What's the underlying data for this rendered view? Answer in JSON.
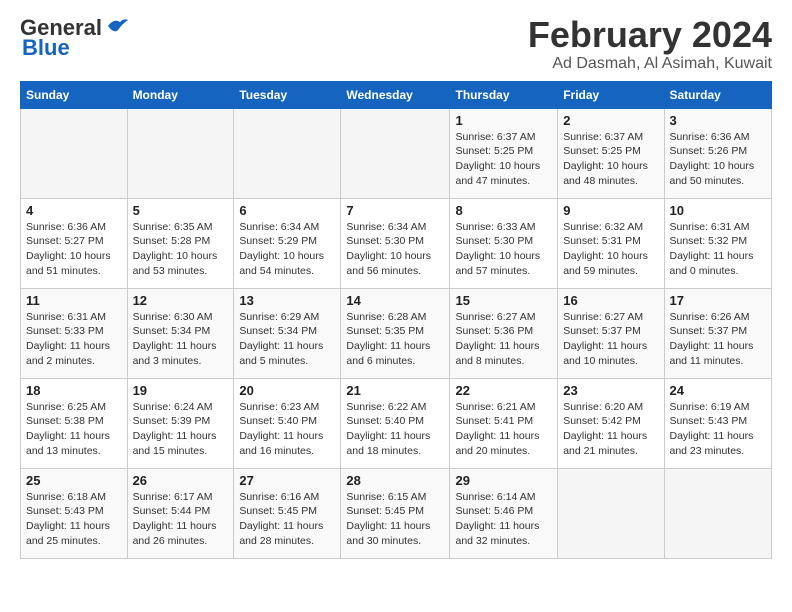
{
  "logo": {
    "line1": "General",
    "line2": "Blue"
  },
  "title": "February 2024",
  "subtitle": "Ad Dasmah, Al Asimah, Kuwait",
  "days_of_week": [
    "Sunday",
    "Monday",
    "Tuesday",
    "Wednesday",
    "Thursday",
    "Friday",
    "Saturday"
  ],
  "weeks": [
    [
      {
        "day": "",
        "info": ""
      },
      {
        "day": "",
        "info": ""
      },
      {
        "day": "",
        "info": ""
      },
      {
        "day": "",
        "info": ""
      },
      {
        "day": "1",
        "info": "Sunrise: 6:37 AM\nSunset: 5:25 PM\nDaylight: 10 hours\nand 47 minutes."
      },
      {
        "day": "2",
        "info": "Sunrise: 6:37 AM\nSunset: 5:25 PM\nDaylight: 10 hours\nand 48 minutes."
      },
      {
        "day": "3",
        "info": "Sunrise: 6:36 AM\nSunset: 5:26 PM\nDaylight: 10 hours\nand 50 minutes."
      }
    ],
    [
      {
        "day": "4",
        "info": "Sunrise: 6:36 AM\nSunset: 5:27 PM\nDaylight: 10 hours\nand 51 minutes."
      },
      {
        "day": "5",
        "info": "Sunrise: 6:35 AM\nSunset: 5:28 PM\nDaylight: 10 hours\nand 53 minutes."
      },
      {
        "day": "6",
        "info": "Sunrise: 6:34 AM\nSunset: 5:29 PM\nDaylight: 10 hours\nand 54 minutes."
      },
      {
        "day": "7",
        "info": "Sunrise: 6:34 AM\nSunset: 5:30 PM\nDaylight: 10 hours\nand 56 minutes."
      },
      {
        "day": "8",
        "info": "Sunrise: 6:33 AM\nSunset: 5:30 PM\nDaylight: 10 hours\nand 57 minutes."
      },
      {
        "day": "9",
        "info": "Sunrise: 6:32 AM\nSunset: 5:31 PM\nDaylight: 10 hours\nand 59 minutes."
      },
      {
        "day": "10",
        "info": "Sunrise: 6:31 AM\nSunset: 5:32 PM\nDaylight: 11 hours\nand 0 minutes."
      }
    ],
    [
      {
        "day": "11",
        "info": "Sunrise: 6:31 AM\nSunset: 5:33 PM\nDaylight: 11 hours\nand 2 minutes."
      },
      {
        "day": "12",
        "info": "Sunrise: 6:30 AM\nSunset: 5:34 PM\nDaylight: 11 hours\nand 3 minutes."
      },
      {
        "day": "13",
        "info": "Sunrise: 6:29 AM\nSunset: 5:34 PM\nDaylight: 11 hours\nand 5 minutes."
      },
      {
        "day": "14",
        "info": "Sunrise: 6:28 AM\nSunset: 5:35 PM\nDaylight: 11 hours\nand 6 minutes."
      },
      {
        "day": "15",
        "info": "Sunrise: 6:27 AM\nSunset: 5:36 PM\nDaylight: 11 hours\nand 8 minutes."
      },
      {
        "day": "16",
        "info": "Sunrise: 6:27 AM\nSunset: 5:37 PM\nDaylight: 11 hours\nand 10 minutes."
      },
      {
        "day": "17",
        "info": "Sunrise: 6:26 AM\nSunset: 5:37 PM\nDaylight: 11 hours\nand 11 minutes."
      }
    ],
    [
      {
        "day": "18",
        "info": "Sunrise: 6:25 AM\nSunset: 5:38 PM\nDaylight: 11 hours\nand 13 minutes."
      },
      {
        "day": "19",
        "info": "Sunrise: 6:24 AM\nSunset: 5:39 PM\nDaylight: 11 hours\nand 15 minutes."
      },
      {
        "day": "20",
        "info": "Sunrise: 6:23 AM\nSunset: 5:40 PM\nDaylight: 11 hours\nand 16 minutes."
      },
      {
        "day": "21",
        "info": "Sunrise: 6:22 AM\nSunset: 5:40 PM\nDaylight: 11 hours\nand 18 minutes."
      },
      {
        "day": "22",
        "info": "Sunrise: 6:21 AM\nSunset: 5:41 PM\nDaylight: 11 hours\nand 20 minutes."
      },
      {
        "day": "23",
        "info": "Sunrise: 6:20 AM\nSunset: 5:42 PM\nDaylight: 11 hours\nand 21 minutes."
      },
      {
        "day": "24",
        "info": "Sunrise: 6:19 AM\nSunset: 5:43 PM\nDaylight: 11 hours\nand 23 minutes."
      }
    ],
    [
      {
        "day": "25",
        "info": "Sunrise: 6:18 AM\nSunset: 5:43 PM\nDaylight: 11 hours\nand 25 minutes."
      },
      {
        "day": "26",
        "info": "Sunrise: 6:17 AM\nSunset: 5:44 PM\nDaylight: 11 hours\nand 26 minutes."
      },
      {
        "day": "27",
        "info": "Sunrise: 6:16 AM\nSunset: 5:45 PM\nDaylight: 11 hours\nand 28 minutes."
      },
      {
        "day": "28",
        "info": "Sunrise: 6:15 AM\nSunset: 5:45 PM\nDaylight: 11 hours\nand 30 minutes."
      },
      {
        "day": "29",
        "info": "Sunrise: 6:14 AM\nSunset: 5:46 PM\nDaylight: 11 hours\nand 32 minutes."
      },
      {
        "day": "",
        "info": ""
      },
      {
        "day": "",
        "info": ""
      }
    ]
  ]
}
